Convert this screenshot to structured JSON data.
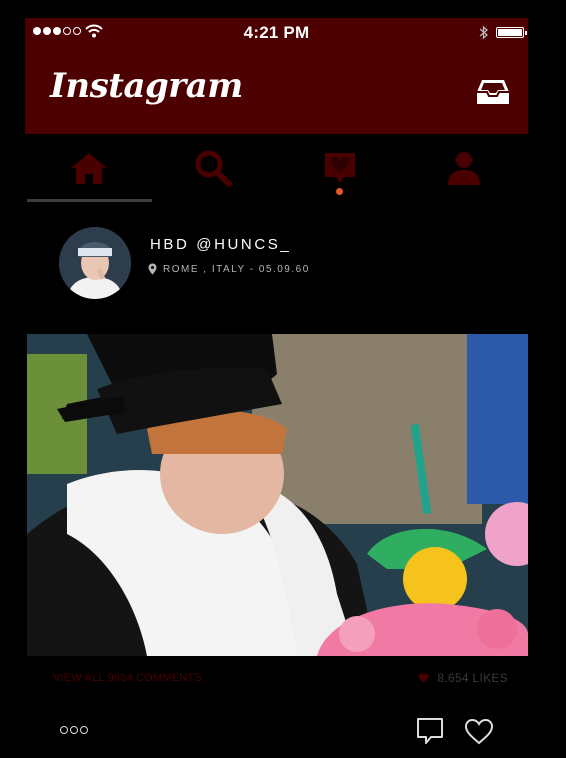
{
  "status_bar": {
    "time": "4:21 PM"
  },
  "header": {
    "app_title": "Instagram"
  },
  "nav_tabs": [
    {
      "icon": "home-icon",
      "active": true
    },
    {
      "icon": "search-icon",
      "active": false
    },
    {
      "icon": "activity-heart-icon",
      "active": false,
      "has_notification": true
    },
    {
      "icon": "profile-icon",
      "active": false
    }
  ],
  "post": {
    "username": "HBD @HUNCS_",
    "location": "ROME , ITALY - 05.09.60",
    "comments_link": "VIEW ALL 9634 COMMENTS",
    "likes": "8.654 LIKES"
  },
  "colors": {
    "header_bg": "#4d0000",
    "nav_icon": "#4a0000",
    "notification_dot": "#e8572a",
    "background": "#000000"
  }
}
